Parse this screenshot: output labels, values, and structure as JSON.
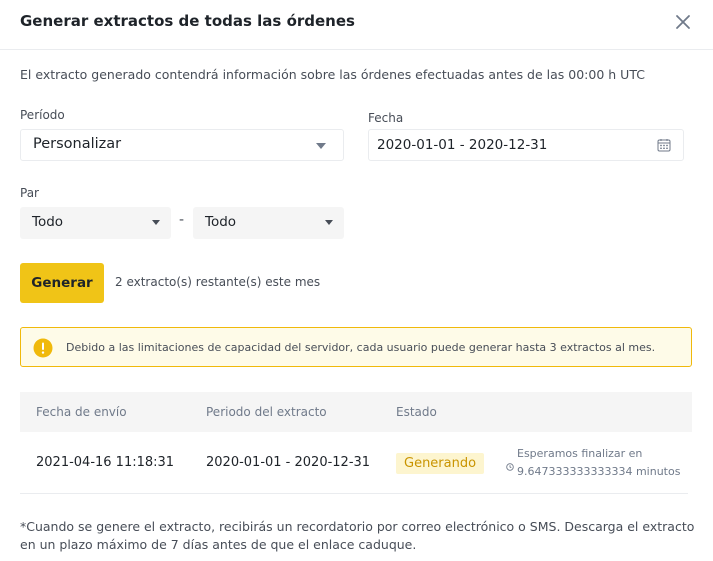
{
  "modal": {
    "title": "Generar extractos de todas las órdenes",
    "intro": "El extracto generado contendrá información sobre las órdenes efectuadas antes de las 00:00 h UTC"
  },
  "form": {
    "period_label": "Período",
    "period_value": "Personalizar",
    "date_label": "Fecha",
    "date_value": "2020-01-01 - 2020-12-31",
    "pair_label": "Par",
    "pair_from": "Todo",
    "pair_separator": "-",
    "pair_to": "Todo",
    "generate_label": "Generar",
    "remaining_text": "2 extracto(s) restante(s) este mes"
  },
  "alert": {
    "text": "Debido a las limitaciones de capacidad del servidor, cada usuario puede generar hasta 3 extractos al mes."
  },
  "table": {
    "headers": [
      "Fecha de envío",
      "Periodo del extracto",
      "Estado"
    ],
    "rows": [
      {
        "sent": "2021-04-16 11:18:31",
        "period": "2020-01-01 - 2020-12-31",
        "status": "Generando",
        "wait_line1": "Esperamos finalizar en",
        "wait_line2": "9.647333333333334 minutos"
      }
    ]
  },
  "footnote": "*Cuando se genere el extracto, recibirás un recordatorio por correo electrónico o SMS. Descarga el extracto en un plazo máximo de 7 días antes de que el enlace caduque.",
  "colors": {
    "accent": "#f0c417",
    "badge_bg": "#fdf5cf",
    "badge_text": "#c99400",
    "alert_border": "#f0b90b"
  }
}
